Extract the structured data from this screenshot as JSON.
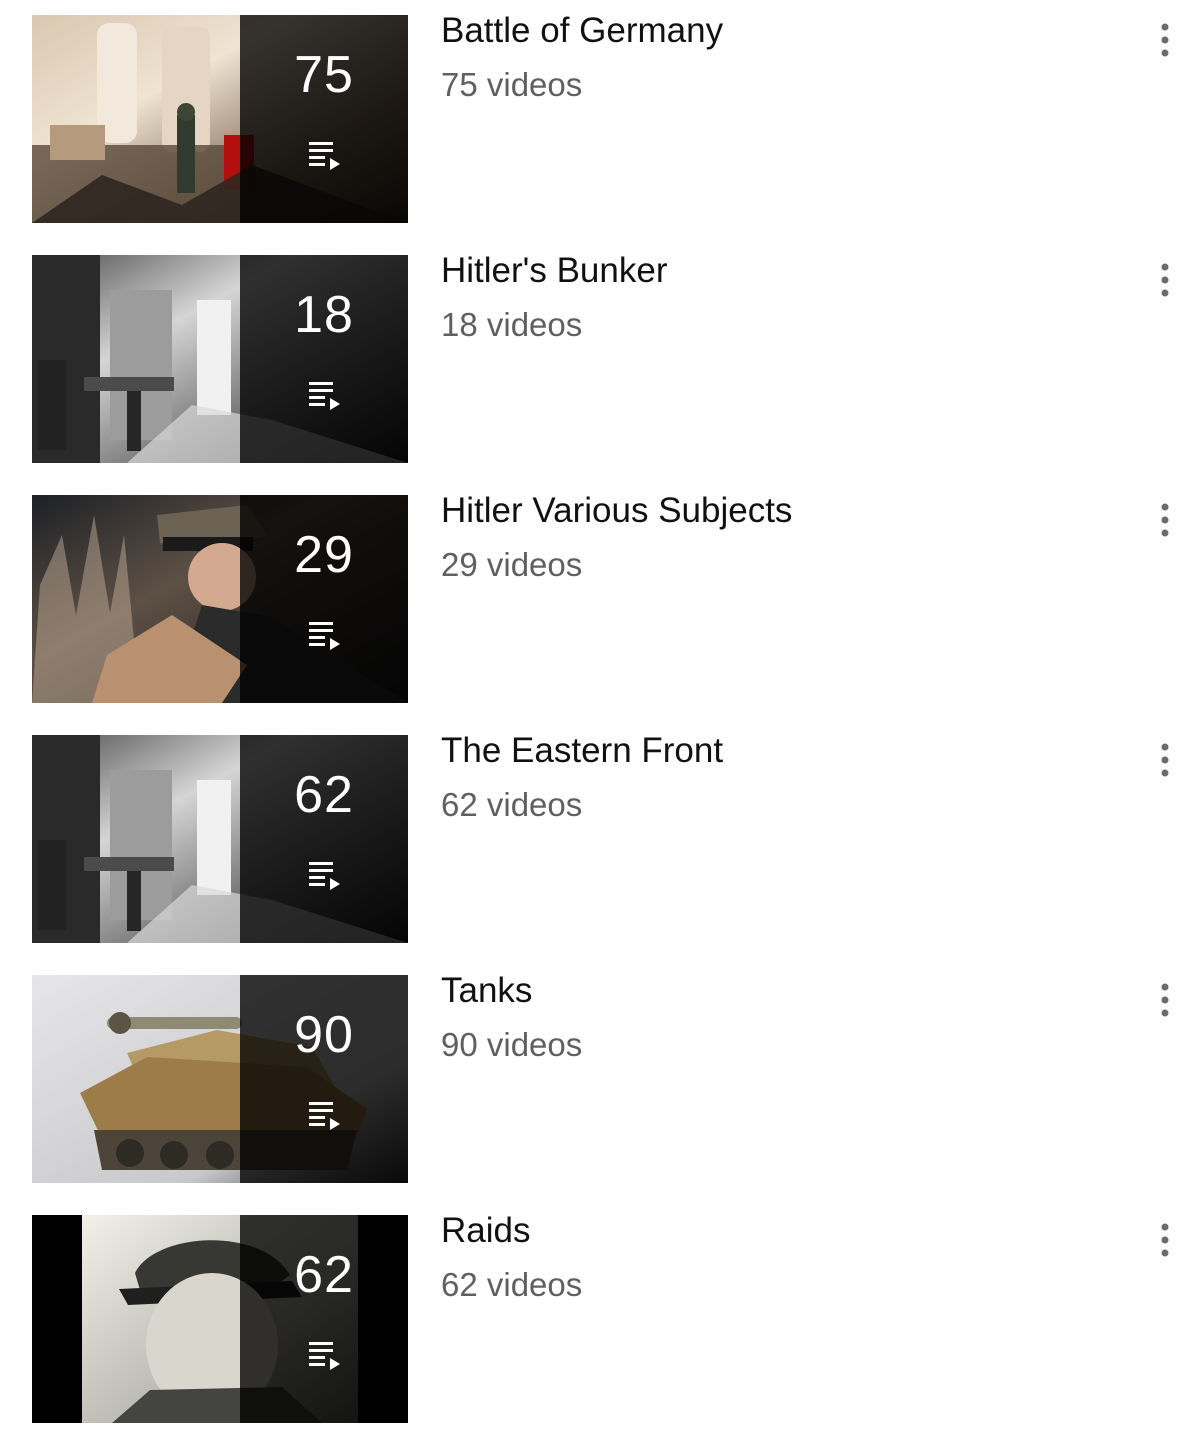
{
  "playlists": [
    {
      "title": "Battle of Germany",
      "video_count": "75",
      "video_count_label": "75 videos",
      "thumbnail": "ruined hall with statues and soldier",
      "colors": {
        "a": "#efe3d2",
        "b": "#8e7a62",
        "c": "#3f3427",
        "d": "#201914"
      }
    },
    {
      "title": "Hitler's Bunker",
      "video_count": "18",
      "video_count_label": "18 videos",
      "thumbnail": "grey bunker room interior",
      "colors": {
        "a": "#f0f0f0",
        "b": "#929292",
        "c": "#3b3b3b",
        "d": "#151515"
      }
    },
    {
      "title": "Hitler Various Subjects",
      "video_count": "29",
      "video_count_label": "29 videos",
      "thumbnail": "officer with dog in dark forest",
      "colors": {
        "a": "#d9a67d",
        "b": "#8a6d52",
        "c": "#3a3330",
        "d": "#1e1b1a"
      }
    },
    {
      "title": "The Eastern Front",
      "video_count": "62",
      "video_count_label": "62 videos",
      "thumbnail": "grey bunker room interior",
      "colors": {
        "a": "#f0f0f0",
        "b": "#929292",
        "c": "#3b3b3b",
        "d": "#151515"
      }
    },
    {
      "title": "Tanks",
      "video_count": "90",
      "video_count_label": "90 videos",
      "thumbnail": "camouflaged model tank on grey background",
      "colors": {
        "a": "#e5e5e7",
        "b": "#b59a65",
        "c": "#7a6238",
        "d": "#383531"
      }
    },
    {
      "title": "Raids",
      "video_count": "62",
      "video_count_label": "62 videos",
      "thumbnail": "black and white portrait of officer in cap",
      "colors": {
        "a": "#e9e9df",
        "b": "#aaa79e",
        "c": "#5b5b57",
        "d": "#000000"
      }
    }
  ],
  "icons": {
    "playlist": "playlist-play-icon",
    "menu": "more-vertical-icon"
  },
  "colors": {
    "background": "#ffffff",
    "title": "#111111",
    "subtitle": "#606060",
    "overlay": "rgba(0,0,0,0.78)",
    "menu_dots": "#6b6b6b"
  }
}
